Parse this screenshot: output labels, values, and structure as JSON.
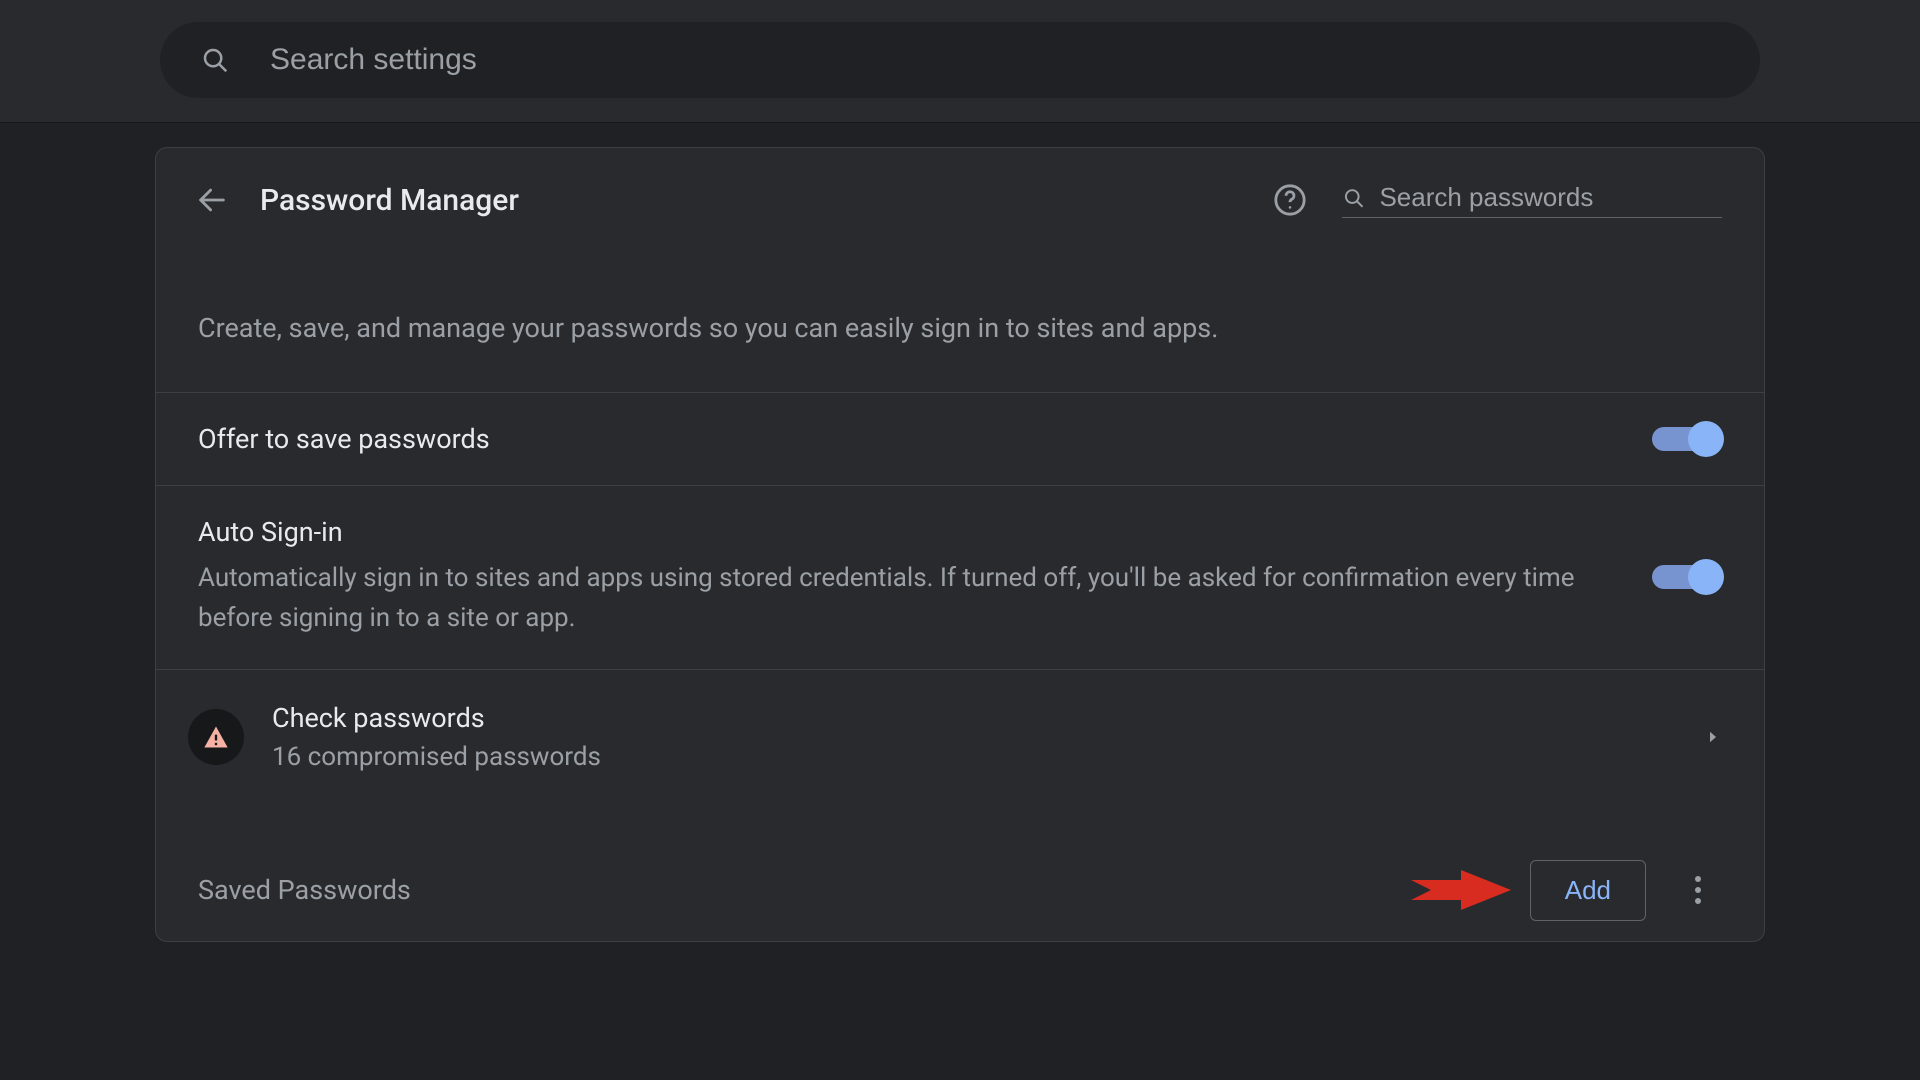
{
  "topSearch": {
    "placeholder": "Search settings"
  },
  "header": {
    "title": "Password Manager",
    "searchPlaceholder": "Search passwords"
  },
  "description": "Create, save, and manage your passwords so you can easily sign in to sites and apps.",
  "settings": {
    "offerSave": {
      "title": "Offer to save passwords",
      "enabled": true
    },
    "autoSignIn": {
      "title": "Auto Sign-in",
      "sub": "Automatically sign in to sites and apps using stored credentials. If turned off, you'll be asked for confirmation every time before signing in to a site or app.",
      "enabled": true
    }
  },
  "checkPasswords": {
    "title": "Check passwords",
    "sub": "16 compromised passwords"
  },
  "savedPasswords": {
    "title": "Saved Passwords",
    "addLabel": "Add"
  }
}
